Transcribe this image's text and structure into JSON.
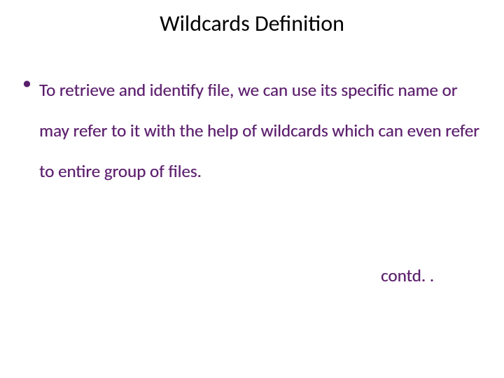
{
  "slide": {
    "title": "Wildcards Definition",
    "bullet": {
      "marker": "•",
      "text": "To retrieve and identify file, we can use its specific name or may refer to it with the help of wildcards which can even refer to entire group of files."
    },
    "contd": "contd. ."
  }
}
